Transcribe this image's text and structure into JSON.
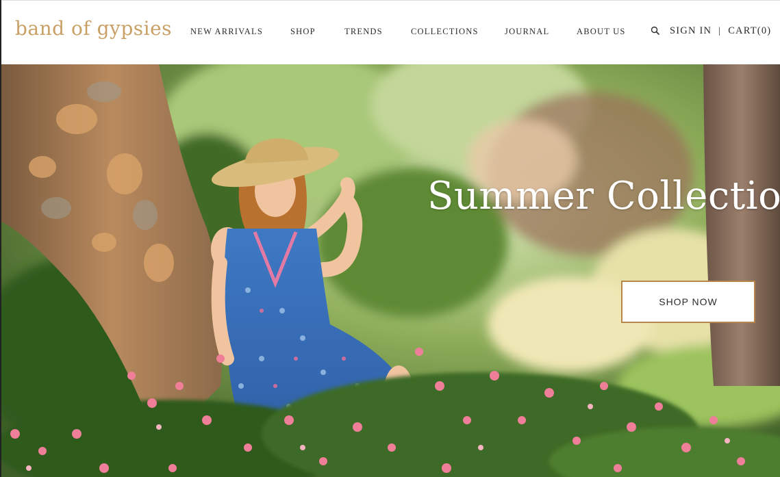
{
  "brand": {
    "logo_text": "band of gypsies",
    "logo_color": "#c9a066"
  },
  "nav": {
    "items": [
      {
        "label": "NEW ARRIVALS"
      },
      {
        "label": "SHOP"
      },
      {
        "label": "TRENDS"
      },
      {
        "label": "COLLECTIONS"
      },
      {
        "label": "JOURNAL"
      },
      {
        "label": "ABOUT US"
      }
    ],
    "search_icon": "search-icon",
    "sign_in_label": "SIGN IN",
    "separator": "|",
    "cart_label": "CART(0)"
  },
  "hero": {
    "title": "Summer Collection",
    "cta_label": "SHOP NOW",
    "cta_border_color": "#b8864a",
    "image_subject": "woman in straw hat and blue floral dress sitting by a tree among pink flowers"
  }
}
